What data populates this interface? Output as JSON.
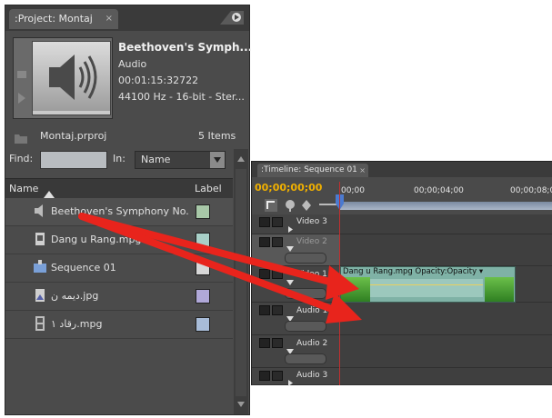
{
  "project": {
    "tab_title": ":Project: Montaj",
    "tab_close": "×",
    "asset": {
      "name": "Beethoven's Symph...",
      "type": "Audio",
      "duration": "00:01:15:32722",
      "format": "44100 Hz - 16-bit - Ster..."
    },
    "project_file": "Montaj.prproj",
    "items_count": "5 Items",
    "find_label": "Find:",
    "find_value": "",
    "in_label": "In:",
    "in_value": "Name",
    "columns": {
      "name": "Name",
      "label": "Label"
    },
    "items": [
      {
        "name": "Beethoven's Symphony No.",
        "icon": "audio-speaker-icon",
        "color": "#a8c8a8"
      },
      {
        "name": "Dang u Rang.mpg",
        "icon": "video-clip-icon",
        "color": "#a8d0c8"
      },
      {
        "name": "Sequence 01",
        "icon": "sequence-icon",
        "color": "#d8d8d8"
      },
      {
        "name": "ديمه ن.jpg",
        "icon": "image-file-icon",
        "color": "#b0a8d8"
      },
      {
        "name": "رقاد ١.mpg",
        "icon": "film-strip-icon",
        "color": "#a8bcd8"
      }
    ]
  },
  "timeline": {
    "tab_title": ":Timeline: Sequence 01",
    "tab_close": "×",
    "timecode": "00;00;00;00",
    "ruler_labels": [
      "00;00",
      "00;00;04;00",
      "00;00;08;00"
    ],
    "tracks": [
      {
        "name": "Video 3"
      },
      {
        "name": "Video 2"
      },
      {
        "name": "Video 1"
      },
      {
        "name": "Audio 1"
      },
      {
        "name": "Audio 2"
      },
      {
        "name": "Audio 3"
      }
    ],
    "clip": {
      "label": "Dang u Rang.mpg  Opacity:Opacity ▾"
    }
  },
  "colors": {
    "panel_bg": "#4b4b4b",
    "timecode": "#f0b000",
    "playhead": "#c03030",
    "arrow": "#e8241c",
    "clip": "#7fb2a6"
  }
}
